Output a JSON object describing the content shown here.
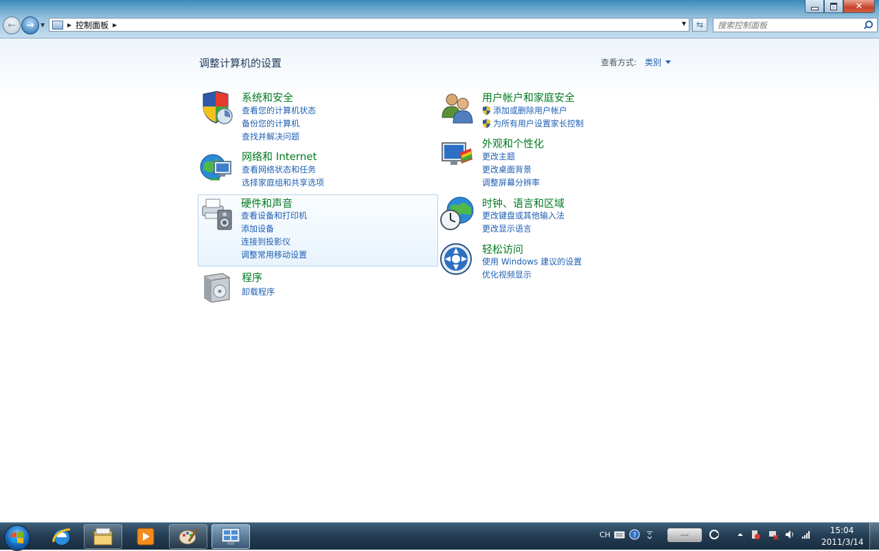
{
  "address_bar": {
    "breadcrumb": "控制面板"
  },
  "search": {
    "placeholder": "搜索控制面板"
  },
  "page": {
    "title": "调整计算机的设置",
    "view_by_label": "查看方式:",
    "view_by_value": "类别"
  },
  "categories": [
    {
      "title": "系统和安全",
      "icon": "shield-icon",
      "links": [
        "查看您的计算机状态",
        "备份您的计算机",
        "查找并解决问题"
      ]
    },
    {
      "title": "网络和 Internet",
      "icon": "network-globe-icon",
      "links": [
        "查看网络状态和任务",
        "选择家庭组和共享选项"
      ]
    },
    {
      "title": "硬件和声音",
      "icon": "printer-speaker-icon",
      "links": [
        "查看设备和打印机",
        "添加设备",
        "连接到投影仪",
        "调整常用移动设置"
      ]
    },
    {
      "title": "程序",
      "icon": "programs-box-icon",
      "links": [
        "卸载程序"
      ]
    },
    {
      "title": "用户帐户和家庭安全",
      "icon": "users-icon",
      "links": [
        "添加或删除用户帐户",
        "为所有用户设置家长控制"
      ]
    },
    {
      "title": "外观和个性化",
      "icon": "monitor-paint-icon",
      "links": [
        "更改主题",
        "更改桌面背景",
        "调整屏幕分辨率"
      ]
    },
    {
      "title": "时钟、语言和区域",
      "icon": "clock-globe-icon",
      "links": [
        "更改键盘或其他输入法",
        "更改显示语言"
      ]
    },
    {
      "title": "轻松访问",
      "icon": "ease-of-access-icon",
      "links": [
        "使用 Windows 建议的设置",
        "优化视频显示"
      ]
    }
  ],
  "taskbar": {
    "language": "CH",
    "network_status": "---",
    "time": "15:04",
    "date": "2011/3/14",
    "items": [
      "start-orb-icon",
      "internet-explorer-icon",
      "file-explorer-icon",
      "media-player-icon",
      "paint-icon",
      "control-panel-icon"
    ]
  },
  "colors": {
    "category_title": "#007a1f",
    "link": "#1e5fb4",
    "heading": "#1e395b",
    "hover_border": "#b7d3ee"
  }
}
